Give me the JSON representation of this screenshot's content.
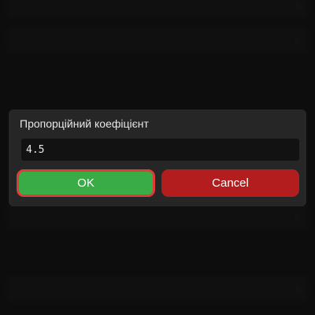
{
  "dialog": {
    "title": "Пропорційний коефіцієнт",
    "input_value": "4.5",
    "ok_label": "OK",
    "cancel_label": "Cancel"
  },
  "colors": {
    "ok_button": "#3aac45",
    "ok_focus_border": "#e03b3b",
    "cancel_button": "#b41d1d",
    "dialog_bg": "#262626",
    "input_bg": "#121212"
  },
  "icons": {
    "chevron": "›"
  }
}
